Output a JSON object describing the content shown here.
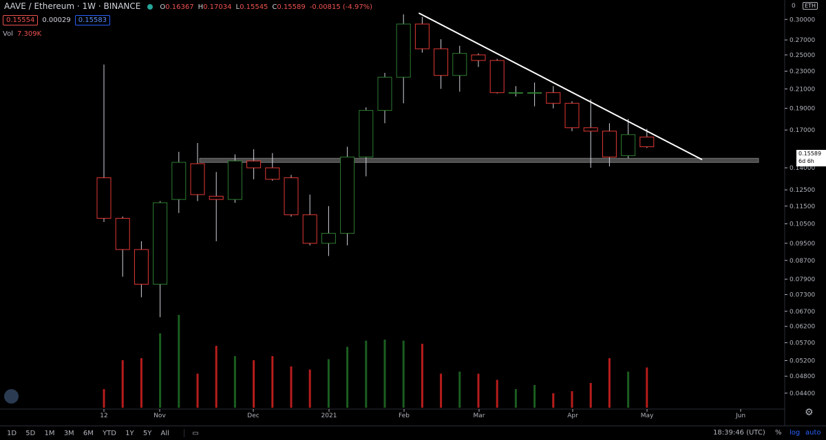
{
  "header": {
    "symbol": "AAVE / Ethereum · 1W · BINANCE",
    "o_label": "O",
    "o_value": "0.16367",
    "h_label": "H",
    "h_value": "0.17034",
    "l_label": "L",
    "l_value": "0.15545",
    "c_label": "C",
    "c_value": "0.15589",
    "change": "-0.00815 (-4.97%)",
    "bid": "0.15554",
    "spread": "0.00029",
    "ask": "0.15583",
    "vol_label": "Vol",
    "vol_value": "7.309K"
  },
  "price_axis": {
    "currency_badge": "ETH",
    "zero_label": "0",
    "ticks": [
      "0.30000",
      "0.27000",
      "0.25000",
      "0.23000",
      "0.21000",
      "0.19000",
      "0.17000",
      "0.14000",
      "0.12500",
      "0.11500",
      "0.10500",
      "0.09500",
      "0.08700",
      "0.07900",
      "0.07300",
      "0.06700",
      "0.06200",
      "0.05700",
      "0.05200",
      "0.04800",
      "0.04400"
    ],
    "last_price": "0.15589",
    "countdown": "6d 6h"
  },
  "time_axis": {
    "ticks": [
      "12",
      "Nov",
      "Dec",
      "2021",
      "Feb",
      "Mar",
      "Apr",
      "May",
      "Jun"
    ]
  },
  "bottom_bar": {
    "timeframes": [
      "1D",
      "5D",
      "1M",
      "3M",
      "6M",
      "YTD",
      "1Y",
      "5Y",
      "All"
    ],
    "clock": "18:39:46 (UTC)",
    "percent": "%",
    "log": "log",
    "auto": "auto"
  },
  "colors": {
    "up": "#26a69a",
    "down": "#ef5350",
    "up_body": "#1b5e20",
    "down_body": "#b71c1c",
    "background": "#000000"
  },
  "chart_data": {
    "type": "candlestick",
    "title": "",
    "log_scale": true,
    "ylim": [
      0.042,
      0.32
    ],
    "x_ticks": [
      "12",
      "Nov",
      "Dec",
      "2021",
      "Feb",
      "Mar",
      "Apr",
      "May",
      "Jun"
    ],
    "candles": [
      {
        "o": 0.133,
        "h": 0.238,
        "l": 0.106,
        "c": 0.108,
        "v": 0.9
      },
      {
        "o": 0.108,
        "h": 0.109,
        "l": 0.08,
        "c": 0.092,
        "v": 2.1
      },
      {
        "o": 0.092,
        "h": 0.096,
        "l": 0.072,
        "c": 0.077,
        "v": 2.2
      },
      {
        "o": 0.077,
        "h": 0.118,
        "l": 0.065,
        "c": 0.117,
        "v": 3.8
      },
      {
        "o": 0.119,
        "h": 0.152,
        "l": 0.111,
        "c": 0.144,
        "v": 5.3
      },
      {
        "o": 0.143,
        "h": 0.159,
        "l": 0.118,
        "c": 0.122,
        "v": 2.0
      },
      {
        "o": 0.121,
        "h": 0.137,
        "l": 0.096,
        "c": 0.119,
        "v": 2.1
      },
      {
        "o": 0.119,
        "h": 0.15,
        "l": 0.117,
        "c": 0.145,
        "v": 2.0
      },
      {
        "o": 0.145,
        "h": 0.154,
        "l": 0.132,
        "c": 0.14,
        "v": 1.8
      },
      {
        "o": 0.14,
        "h": 0.151,
        "l": 0.131,
        "c": 0.132,
        "v": 2.1
      },
      {
        "o": 0.133,
        "h": 0.135,
        "l": 0.109,
        "c": 0.11,
        "v": 0.8
      },
      {
        "o": 0.11,
        "h": 0.122,
        "l": 0.094,
        "c": 0.095,
        "v": 1.0
      },
      {
        "o": 0.095,
        "h": 0.115,
        "l": 0.089,
        "c": 0.1,
        "v": 2.1
      },
      {
        "o": 0.1,
        "h": 0.156,
        "l": 0.094,
        "c": 0.148,
        "v": 2.6
      },
      {
        "o": 0.148,
        "h": 0.191,
        "l": 0.134,
        "c": 0.188,
        "v": 1.9
      },
      {
        "o": 0.188,
        "h": 0.228,
        "l": 0.176,
        "c": 0.223,
        "v": 2.4
      },
      {
        "o": 0.223,
        "h": 0.308,
        "l": 0.195,
        "c": 0.293,
        "v": 1.6
      },
      {
        "o": 0.293,
        "h": 0.304,
        "l": 0.253,
        "c": 0.258,
        "v": 1.5
      },
      {
        "o": 0.258,
        "h": 0.271,
        "l": 0.21,
        "c": 0.225,
        "v": 0.9
      },
      {
        "o": 0.225,
        "h": 0.262,
        "l": 0.207,
        "c": 0.252,
        "v": 0.9
      },
      {
        "o": 0.25,
        "h": 0.252,
        "l": 0.235,
        "c": 0.243,
        "v": 1.0
      },
      {
        "o": 0.243,
        "h": 0.245,
        "l": 0.205,
        "c": 0.206,
        "v": 0.8
      },
      {
        "o": 0.206,
        "h": 0.213,
        "l": 0.202,
        "c": 0.206,
        "v": 0.7
      },
      {
        "o": 0.206,
        "h": 0.217,
        "l": 0.192,
        "c": 0.206,
        "v": 0.7
      },
      {
        "o": 0.206,
        "h": 0.213,
        "l": 0.19,
        "c": 0.195,
        "v": 0.7
      },
      {
        "o": 0.195,
        "h": 0.197,
        "l": 0.169,
        "c": 0.172,
        "v": 0.7
      },
      {
        "o": 0.172,
        "h": 0.199,
        "l": 0.14,
        "c": 0.169,
        "v": 0.7
      },
      {
        "o": 0.169,
        "h": 0.176,
        "l": 0.141,
        "c": 0.148,
        "v": 0.8
      },
      {
        "o": 0.149,
        "h": 0.18,
        "l": 0.147,
        "c": 0.166,
        "v": 0.7
      },
      {
        "o": 0.164,
        "h": 0.171,
        "l": 0.155,
        "c": 0.156,
        "v": 0.5
      }
    ],
    "volume_bars_relative": [
      0.18,
      0.46,
      0.48,
      0.72,
      0.9,
      0.33,
      0.6,
      0.5,
      0.46,
      0.5,
      0.4,
      0.37,
      0.47,
      0.59,
      0.65,
      0.66,
      0.65,
      0.62,
      0.33,
      0.35,
      0.33,
      0.27,
      0.18,
      0.22,
      0.14,
      0.16,
      0.24,
      0.48,
      0.35,
      0.39
    ],
    "support_zone": [
      0.144,
      0.147
    ],
    "trendline": {
      "start_price": 0.31,
      "end_price": 0.146
    }
  }
}
